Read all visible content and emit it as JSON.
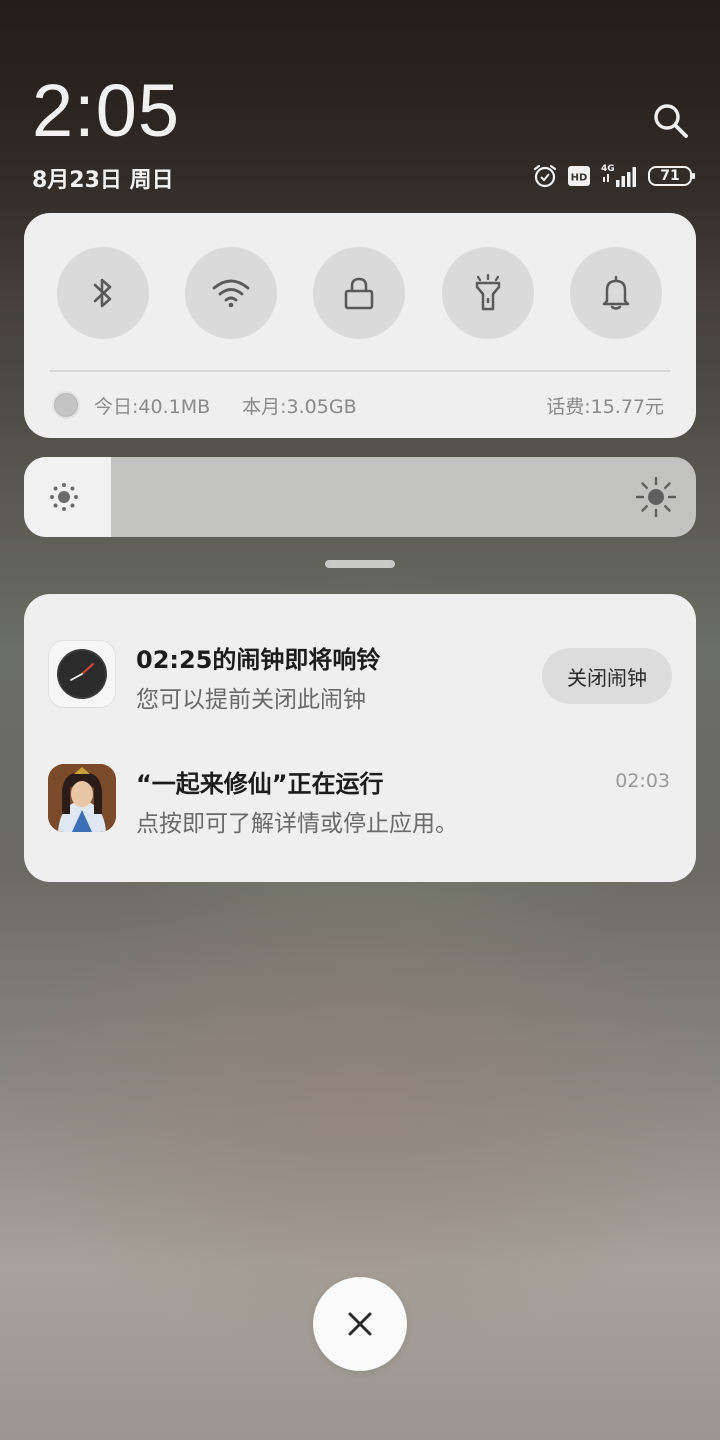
{
  "header": {
    "time": "2:05",
    "date": "8月23日 周日",
    "status": {
      "network": "4G",
      "hd_badge": "HD",
      "battery": "71"
    }
  },
  "quick_settings": {
    "toggles": [
      {
        "icon": "bluetooth-icon"
      },
      {
        "icon": "wifi-icon"
      },
      {
        "icon": "lock-icon"
      },
      {
        "icon": "flashlight-icon"
      },
      {
        "icon": "bell-icon"
      }
    ],
    "data_usage": {
      "today": "今日:40.1MB",
      "month": "本月:3.05GB",
      "fee": "话费:15.77元"
    }
  },
  "brightness": {
    "level": 0.13
  },
  "notifications": [
    {
      "app_icon": "clock-app-icon",
      "title": "02:25的闹钟即将响铃",
      "body": "您可以提前关闭此闹钟",
      "action": "关闭闹钟"
    },
    {
      "app_icon": "game-app-icon",
      "title": "“一起来修仙”正在运行",
      "body": "点按即可了解详情或停止应用。",
      "time": "02:03"
    }
  ],
  "colors": {
    "card": "#efefef",
    "toggle_bg": "#dadada",
    "accent_red": "#d9463b"
  }
}
